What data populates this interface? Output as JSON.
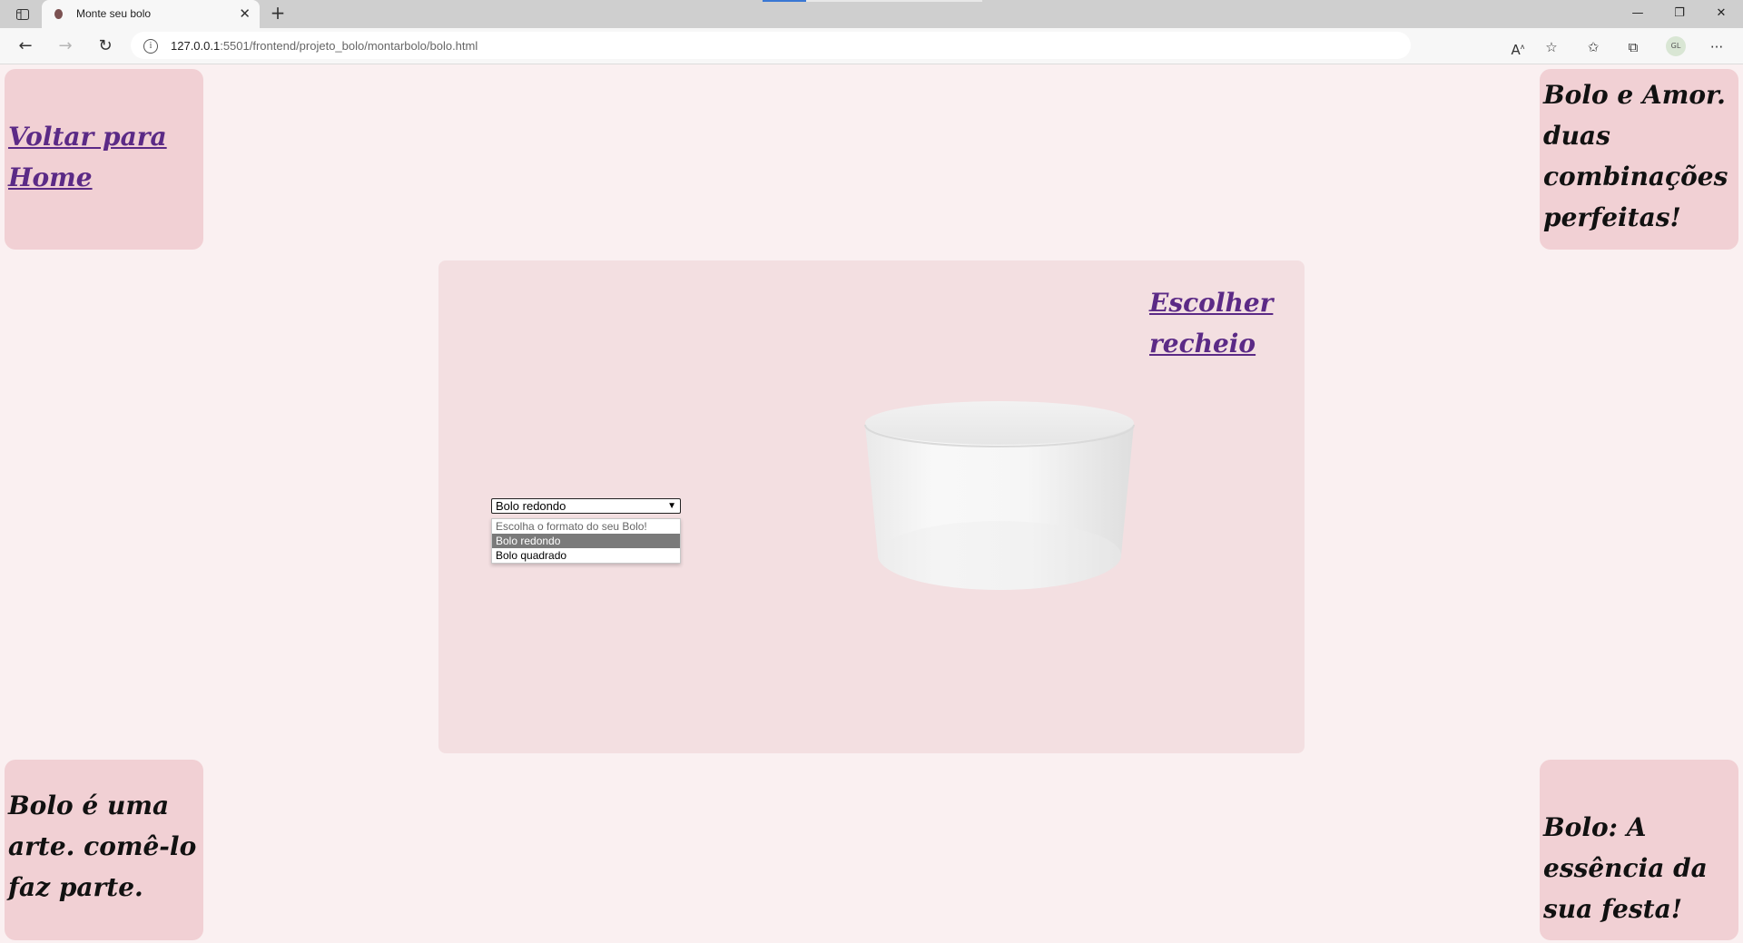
{
  "browser": {
    "tab_title": "Monte seu bolo",
    "tab_close": "✕",
    "new_tab": "+",
    "url_host": "127.0.0.1",
    "url_rest": ":5501/frontend/projeto_bolo/montarbolo/bolo.html",
    "profile_initials": "GL",
    "window_controls": {
      "minimize": "—",
      "restore": "❐",
      "close": "✕"
    },
    "icons": [
      "tab-actions-icon",
      "back-icon",
      "forward-icon",
      "refresh-icon",
      "info-icon",
      "read-aloud-icon",
      "add-favorite-icon",
      "favorites-icon",
      "collections-icon",
      "more-icon"
    ]
  },
  "page": {
    "home_link": "Voltar para Home",
    "quote_top_right": "Bolo e Amor. duas combinações perfeitas!",
    "quote_bottom_left": "Bolo é uma arte. comê-lo faz parte.",
    "quote_bottom_right": "Bolo: A essência da sua festa!",
    "recheio_link": "Escolher recheio",
    "shape_select": {
      "selected": "Bolo redondo",
      "options": [
        {
          "label": "Escolha o formato do seu Bolo!",
          "state": "placeholder"
        },
        {
          "label": "Bolo redondo",
          "state": "selected"
        },
        {
          "label": "Bolo quadrado",
          "state": "normal"
        }
      ]
    },
    "cake_model": "round-cake-3d",
    "colors": {
      "background": "#faf0f1",
      "card": "#f1d0d4",
      "panel": "#f3dfe1",
      "link": "#5b2a86"
    }
  }
}
